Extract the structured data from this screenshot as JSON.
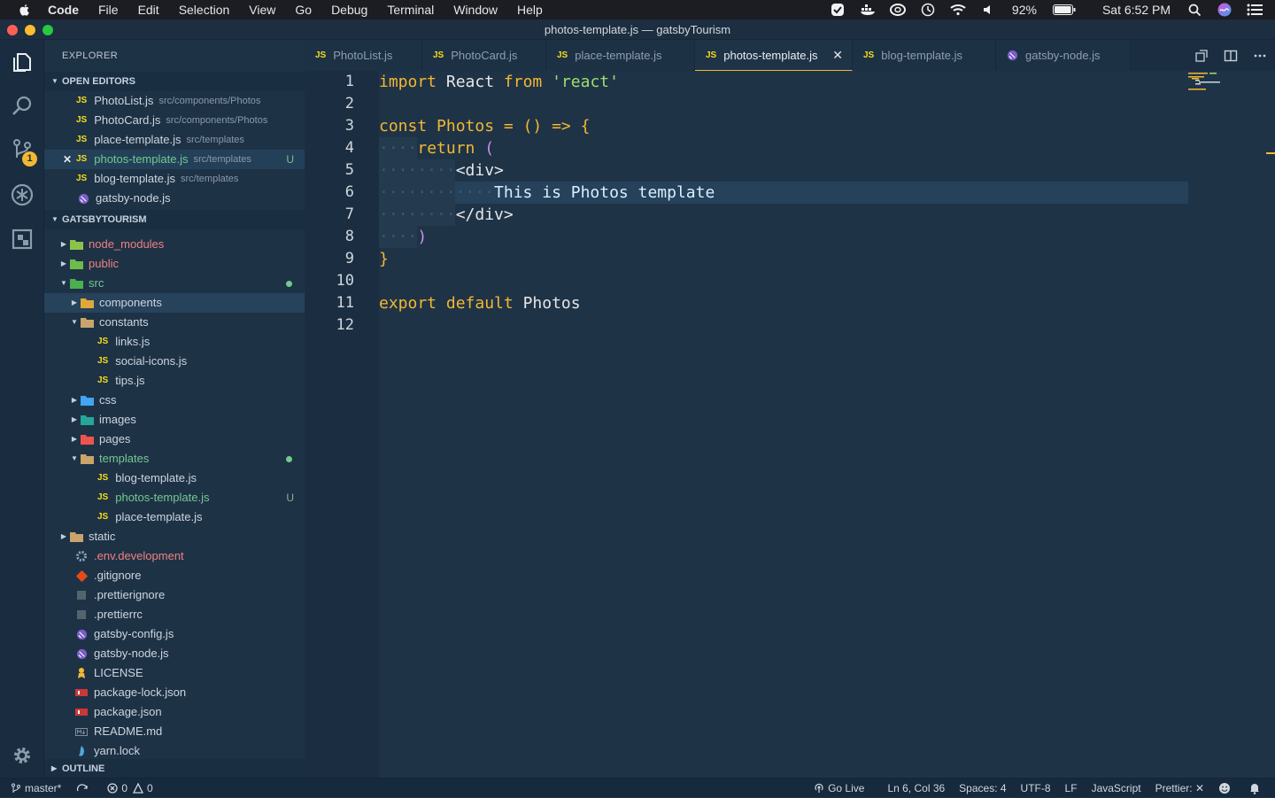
{
  "menubar": {
    "items": [
      "Code",
      "File",
      "Edit",
      "Selection",
      "View",
      "Go",
      "Debug",
      "Terminal",
      "Window",
      "Help"
    ],
    "battery": "92%",
    "clock": "Sat 6:52 PM"
  },
  "window": {
    "title": "photos-template.js — gatsbyTourism"
  },
  "activity": {
    "scm_badge": "1"
  },
  "sidebar": {
    "title": "EXPLORER",
    "open_editors_label": "OPEN EDITORS",
    "open_editors": [
      {
        "name": "PhotoList.js",
        "path": "src/components/Photos"
      },
      {
        "name": "PhotoCard.js",
        "path": "src/components/Photos"
      },
      {
        "name": "place-template.js",
        "path": "src/templates"
      },
      {
        "name": "photos-template.js",
        "path": "src/templates",
        "status": "U"
      },
      {
        "name": "blog-template.js",
        "path": "src/templates"
      },
      {
        "name": "gatsby-node.js",
        "path": ""
      }
    ],
    "project_label": "GATSBYTOURISM",
    "tree": {
      "node_modules": "node_modules",
      "public": "public",
      "src": "src",
      "components": "components",
      "constants": "constants",
      "links": "links.js",
      "social_icons": "social-icons.js",
      "tips": "tips.js",
      "css": "css",
      "images": "images",
      "pages": "pages",
      "templates": "templates",
      "blog_template": "blog-template.js",
      "photos_template": "photos-template.js",
      "photos_status": "U",
      "place_template": "place-template.js",
      "static": "static",
      "env": ".env.development",
      "gitignore": ".gitignore",
      "prettierignore": ".prettierignore",
      "prettierrc": ".prettierrc",
      "gatsby_config": "gatsby-config.js",
      "gatsby_node": "gatsby-node.js",
      "license": "LICENSE",
      "package_lock": "package-lock.json",
      "package_json": "package.json",
      "readme": "README.md",
      "yarn_lock": "yarn.lock"
    },
    "outline_label": "OUTLINE"
  },
  "tabs": [
    {
      "label": "PhotoList.js",
      "icon": "JS"
    },
    {
      "label": "PhotoCard.js",
      "icon": "JS"
    },
    {
      "label": "place-template.js",
      "icon": "JS"
    },
    {
      "label": "photos-template.js",
      "icon": "JS"
    },
    {
      "label": "blog-template.js",
      "icon": "JS"
    },
    {
      "label": "gatsby-node.js",
      "icon": "gatsby"
    }
  ],
  "editor": {
    "line_numbers": [
      "1",
      "2",
      "3",
      "4",
      "5",
      "6",
      "7",
      "8",
      "9",
      "10",
      "11",
      "12"
    ],
    "code": {
      "l1_kw": "import",
      "l1_id": "React",
      "l1_kw2": "from",
      "l1_str": "'react'",
      "l3_kw": "const",
      "l3_id": "Photos",
      "l3_op": "= () =>",
      "l3_brace": "{",
      "l4_kw": "return",
      "l4_paren": "(",
      "l5_tag": "<div>",
      "l6_text": "This is Photos template",
      "l7_tag": "</div>",
      "l8_paren": ")",
      "l9_brace": "}",
      "l11_kw": "export",
      "l11_kw2": "default",
      "l11_id": "Photos"
    }
  },
  "statusbar": {
    "branch": "master*",
    "errors": "0",
    "warnings": "0",
    "go_live": "Go Live",
    "position": "Ln 6, Col 36",
    "spaces": "Spaces: 4",
    "encoding": "UTF-8",
    "eol": "LF",
    "language": "JavaScript",
    "prettier": "Prettier: ✕"
  },
  "colors": {
    "accent": "#f2b832",
    "js_badge": "#f5de19",
    "untracked": "#73c991",
    "string": "#9de06f"
  }
}
